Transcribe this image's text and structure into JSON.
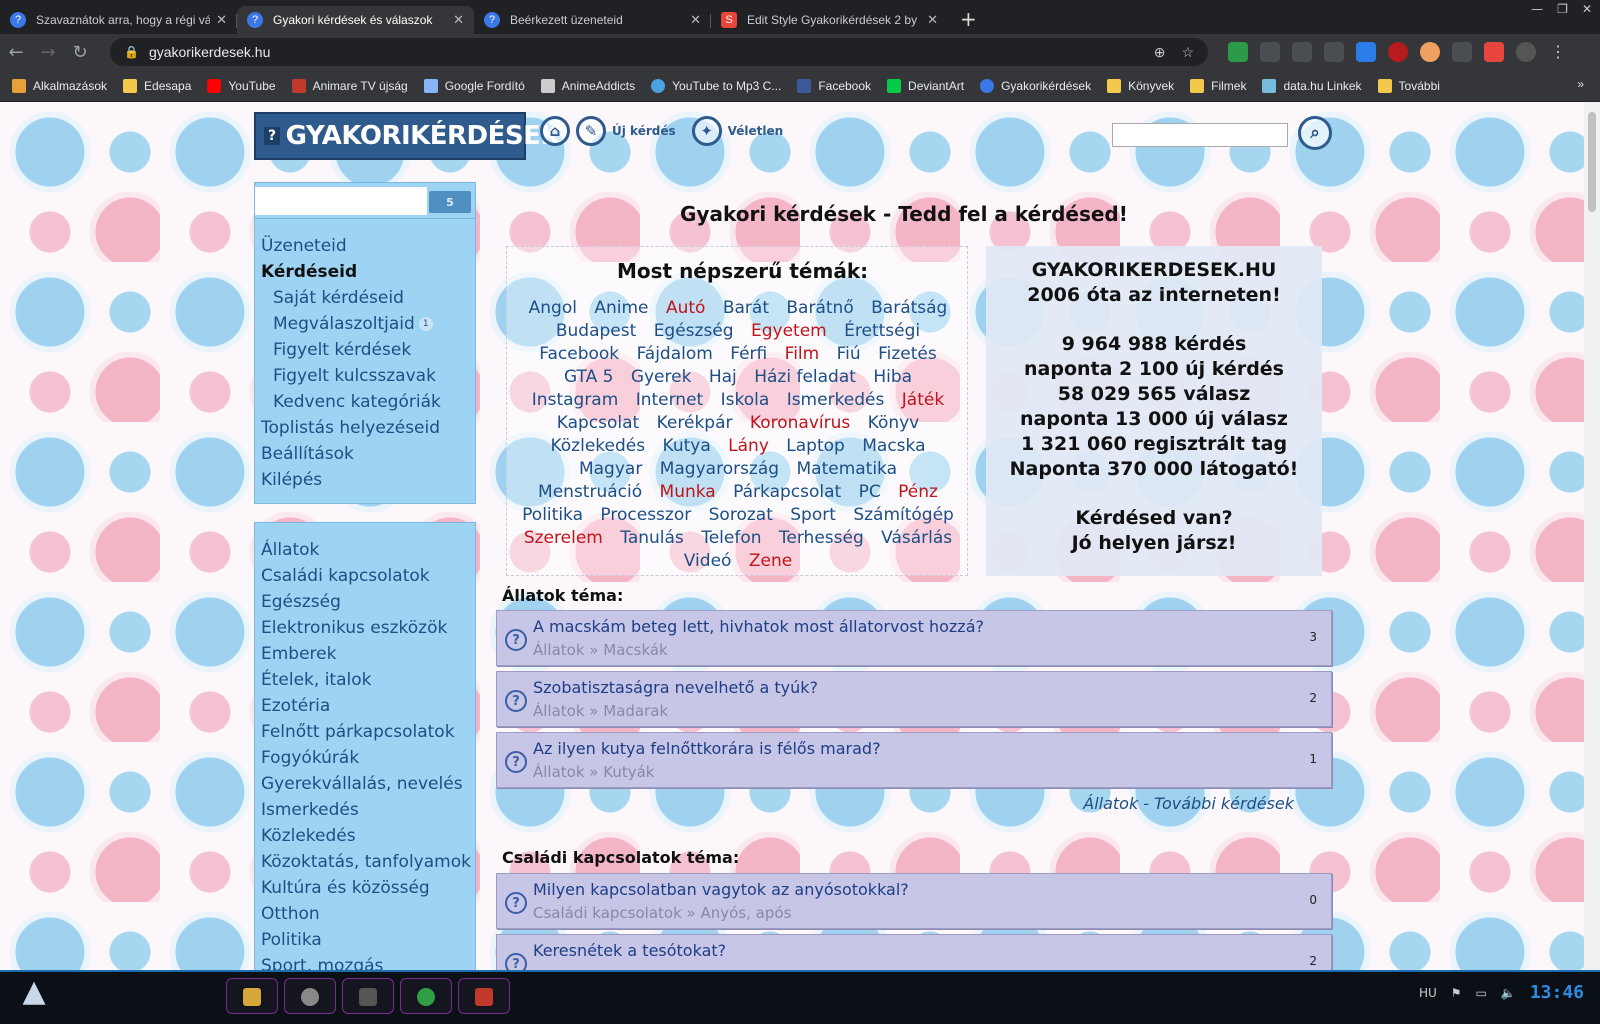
{
  "browser": {
    "tabs": [
      {
        "title": "Szavaznátok arra, hogy a régi vá",
        "active": false
      },
      {
        "title": "Gyakori kérdések és válaszok",
        "active": true
      },
      {
        "title": "Beérkezett üzeneteid",
        "active": false
      },
      {
        "title": "Edit Style Gyakorikérdések 2 by",
        "active": false
      }
    ],
    "url": "gyakorikerdesek.hu",
    "bookmarks": [
      "Alkalmazások",
      "Edesapa",
      "YouTube",
      "Animare TV újság",
      "Google Fordító",
      "AnimeAddicts",
      "YouTube to Mp3 C...",
      "Facebook",
      "DeviantArt",
      "Gyakorikérdések",
      "Könyvek",
      "Filmek",
      "data.hu Linkek",
      "További"
    ]
  },
  "site": {
    "logo": "GYAKORIKÉRDÉSEK",
    "new_question": "Új kérdés",
    "random": "Véletlen",
    "title": "Gyakori kérdések - Tedd fel a kérdésed!"
  },
  "user_menu": {
    "count": "5",
    "items": [
      {
        "label": "Üzeneteid"
      },
      {
        "label": "Kérdéseid"
      },
      {
        "label": "Saját kérdéseid"
      },
      {
        "label": "Megválaszoltjaid",
        "badge": "1"
      },
      {
        "label": "Figyelt kérdések"
      },
      {
        "label": "Figyelt kulcsszavak"
      },
      {
        "label": "Kedvenc kategóriák"
      },
      {
        "label": "Toplistás helyezéseid"
      },
      {
        "label": "Beállítások"
      },
      {
        "label": "Kilépés"
      }
    ]
  },
  "categories": [
    "Állatok",
    "Családi kapcsolatok",
    "Egészség",
    "Elektronikus eszközök",
    "Emberek",
    "Ételek, italok",
    "Ezotéria",
    "Felnőtt párkapcsolatok",
    "Fogyókúrák",
    "Gyerekvállalás, nevelés",
    "Ismerkedés",
    "Közlekedés",
    "Közoktatás, tanfolyamok",
    "Kultúra és közösség",
    "Otthon",
    "Politika",
    "Sport, mozgás"
  ],
  "popular": {
    "heading": "Most népszerű témák:",
    "tags": [
      {
        "t": "Angol",
        "r": false
      },
      {
        "t": "Anime",
        "r": false
      },
      {
        "t": "Autó",
        "r": true
      },
      {
        "t": "Barát",
        "r": false
      },
      {
        "t": "Barátnő",
        "r": false
      },
      {
        "t": "Barátság",
        "r": false
      },
      {
        "t": "Budapest",
        "r": false
      },
      {
        "t": "Egészség",
        "r": false
      },
      {
        "t": "Egyetem",
        "r": true
      },
      {
        "t": "Érettségi",
        "r": false
      },
      {
        "t": "Facebook",
        "r": false
      },
      {
        "t": "Fájdalom",
        "r": false
      },
      {
        "t": "Férfi",
        "r": false
      },
      {
        "t": "Film",
        "r": true
      },
      {
        "t": "Fiú",
        "r": false
      },
      {
        "t": "Fizetés",
        "r": false
      },
      {
        "t": "GTA 5",
        "r": false
      },
      {
        "t": "Gyerek",
        "r": false
      },
      {
        "t": "Haj",
        "r": false
      },
      {
        "t": "Házi feladat",
        "r": false
      },
      {
        "t": "Hiba",
        "r": false
      },
      {
        "t": "Instagram",
        "r": false
      },
      {
        "t": "Internet",
        "r": false
      },
      {
        "t": "Iskola",
        "r": false
      },
      {
        "t": "Ismerkedés",
        "r": false
      },
      {
        "t": "Játék",
        "r": true
      },
      {
        "t": "Kapcsolat",
        "r": false
      },
      {
        "t": "Kerékpár",
        "r": false
      },
      {
        "t": "Koronavírus",
        "r": true
      },
      {
        "t": "Könyv",
        "r": false
      },
      {
        "t": "Közlekedés",
        "r": false
      },
      {
        "t": "Kutya",
        "r": false
      },
      {
        "t": "Lány",
        "r": true
      },
      {
        "t": "Laptop",
        "r": false
      },
      {
        "t": "Macska",
        "r": false
      },
      {
        "t": "Magyar",
        "r": false
      },
      {
        "t": "Magyarország",
        "r": false
      },
      {
        "t": "Matematika",
        "r": false
      },
      {
        "t": "Menstruáció",
        "r": false
      },
      {
        "t": "Munka",
        "r": true
      },
      {
        "t": "Párkapcsolat",
        "r": false
      },
      {
        "t": "PC",
        "r": false
      },
      {
        "t": "Pénz",
        "r": true
      },
      {
        "t": "Politika",
        "r": false
      },
      {
        "t": "Processzor",
        "r": false
      },
      {
        "t": "Sorozat",
        "r": false
      },
      {
        "t": "Sport",
        "r": false
      },
      {
        "t": "Számítógép",
        "r": false
      },
      {
        "t": "Szerelem",
        "r": true
      },
      {
        "t": "Tanulás",
        "r": false
      },
      {
        "t": "Telefon",
        "r": false
      },
      {
        "t": "Terhesség",
        "r": false
      },
      {
        "t": "Vásárlás",
        "r": false
      },
      {
        "t": "Videó",
        "r": false
      },
      {
        "t": "Zene",
        "r": true
      }
    ]
  },
  "stats": {
    "lines1": [
      "GYAKORIKERDESEK.HU",
      "2006 óta az interneten!"
    ],
    "lines2": [
      "9 964 988 kérdés",
      "naponta 2 100 új kérdés",
      "58 029 565 válasz",
      "naponta 13 000 új válasz",
      "1 321 060 regisztrált tag",
      "Naponta 370 000 látogató!"
    ],
    "lines3": [
      "Kérdésed van?",
      "Jó helyen jársz!"
    ]
  },
  "sections": [
    {
      "title": "Állatok téma:",
      "questions": [
        {
          "title": "A macskám beteg lett, hivhatok most állatorvost hozzá?",
          "cat": "Állatok » Macskák",
          "n": "3"
        },
        {
          "title": "Szobatisztaságra nevelhető a tyúk?",
          "cat": "Állatok » Madarak",
          "n": "2"
        },
        {
          "title": "Az ilyen kutya felnőttkorára is félős marad?",
          "cat": "Állatok » Kutyák",
          "n": "1"
        }
      ],
      "more": "Állatok - További kérdések"
    },
    {
      "title": "Családi kapcsolatok téma:",
      "questions": [
        {
          "title": "Milyen kapcsolatban vagytok az anyósotokkal?",
          "cat": "Családi kapcsolatok » Anyós, após",
          "n": "0"
        },
        {
          "title": "Keresnétek a tesótokat?",
          "cat": "",
          "n": "2"
        }
      ]
    }
  ],
  "taskbar": {
    "lang": "HU",
    "time": "13:46"
  }
}
